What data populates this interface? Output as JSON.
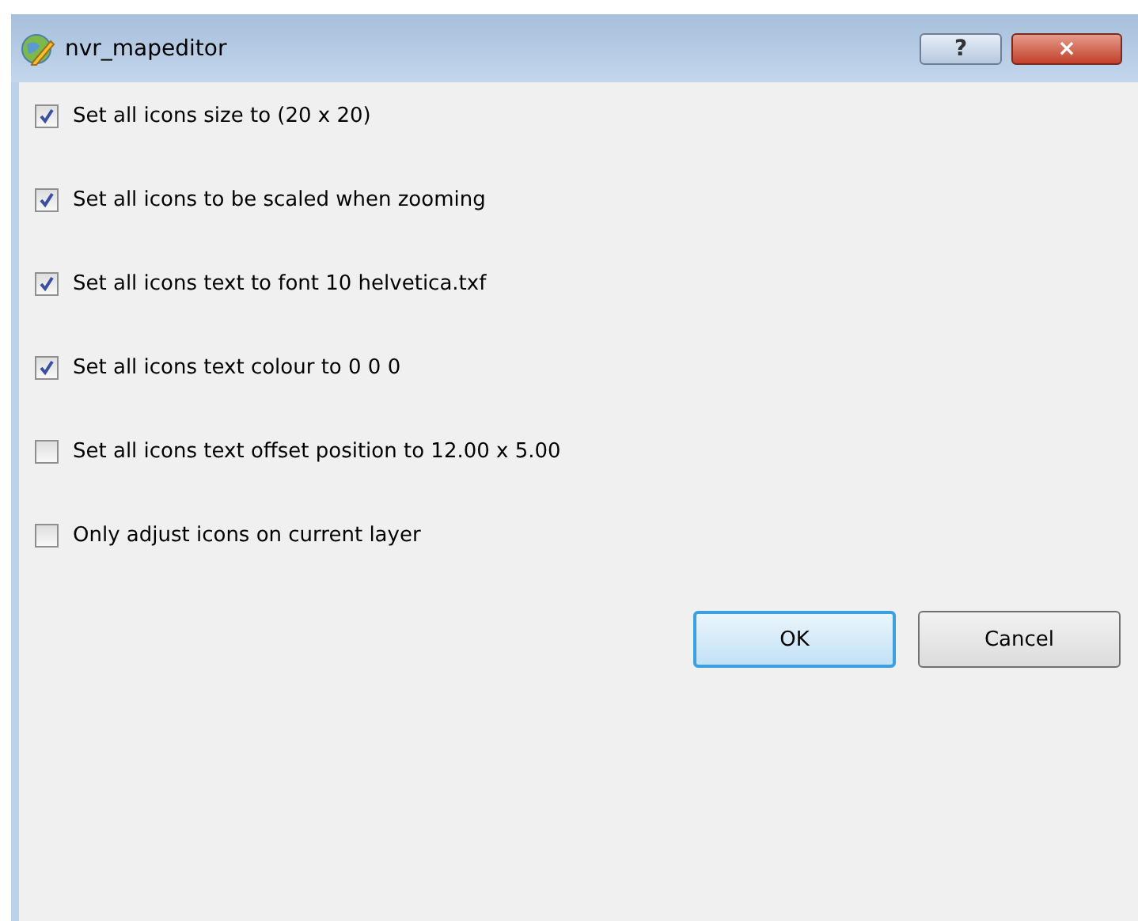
{
  "window": {
    "title": "nvr_mapeditor",
    "help_button": "?",
    "close_button": "×"
  },
  "options": [
    {
      "label": "Set all icons size to (20 x 20)",
      "checked": true
    },
    {
      "label": "Set all icons to be scaled when zooming",
      "checked": true
    },
    {
      "label": "Set all icons text to font 10 helvetica.txf",
      "checked": true
    },
    {
      "label": "Set all icons text colour to 0 0 0",
      "checked": true
    },
    {
      "label": "Set all icons text offset position to 12.00 x 5.00",
      "checked": false
    },
    {
      "label": "Only adjust icons on current layer",
      "checked": false
    }
  ],
  "buttons": [
    {
      "label": "OK",
      "default": true
    },
    {
      "label": "Cancel",
      "default": false
    }
  ]
}
